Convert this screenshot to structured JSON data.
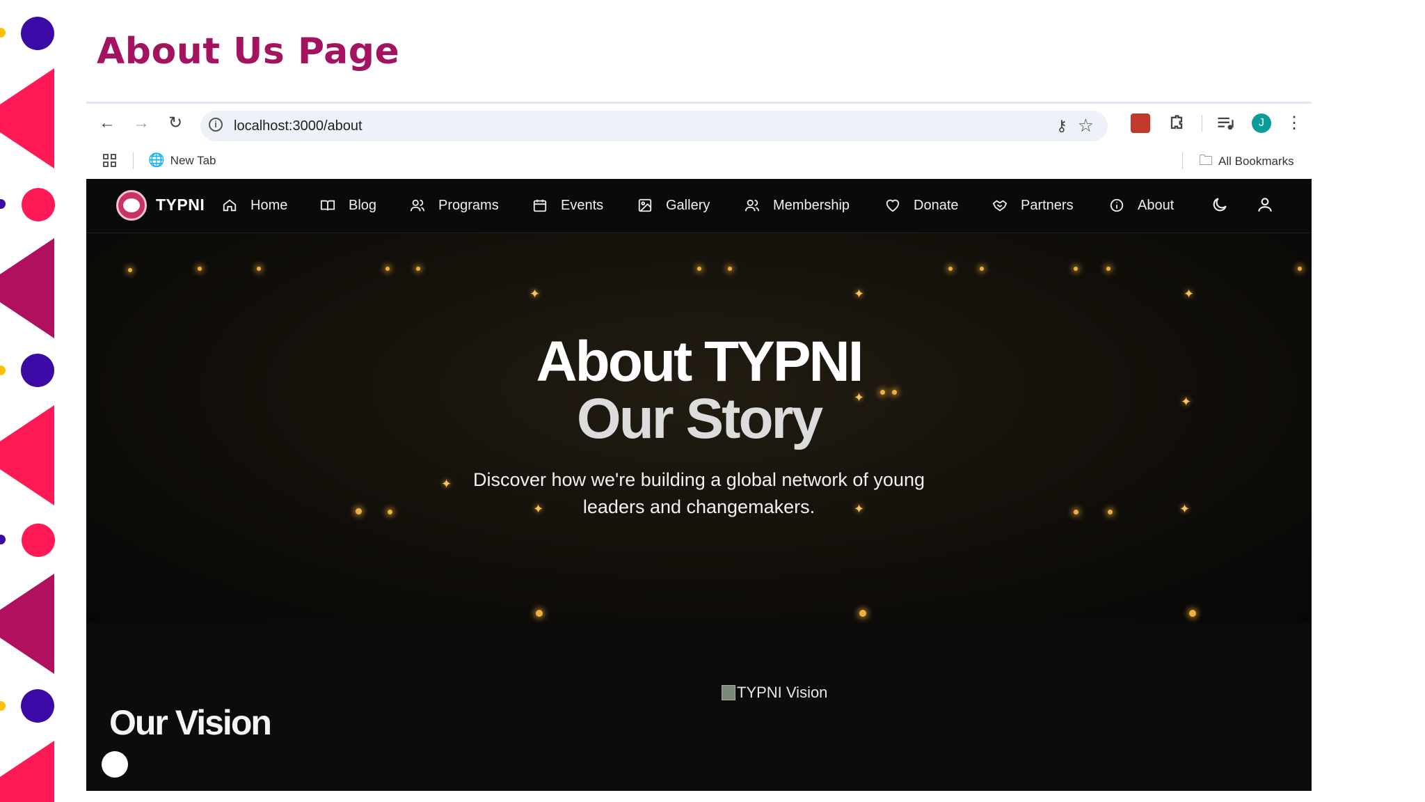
{
  "slide": {
    "title": "About Us Page"
  },
  "browser": {
    "url": "localhost:3000/about",
    "bookmarks": {
      "new_tab": "New Tab",
      "all_bookmarks": "All Bookmarks"
    },
    "profile_initial": "J"
  },
  "site": {
    "brand": "TYPNI",
    "nav": [
      {
        "label": "Home",
        "icon": "home-icon"
      },
      {
        "label": "Blog",
        "icon": "book-icon"
      },
      {
        "label": "Programs",
        "icon": "users-icon"
      },
      {
        "label": "Events",
        "icon": "calendar-icon"
      },
      {
        "label": "Gallery",
        "icon": "image-icon"
      },
      {
        "label": "Membership",
        "icon": "users-icon"
      },
      {
        "label": "Donate",
        "icon": "heart-icon"
      },
      {
        "label": "Partners",
        "icon": "handshake-icon"
      },
      {
        "label": "About",
        "icon": "info-icon"
      }
    ],
    "hero": {
      "title_line1": "About TYPNI",
      "title_line2": "Our Story",
      "subtitle_line1": "Discover how we're building a global network of young",
      "subtitle_line2": "leaders and changemakers."
    },
    "vision": {
      "image_alt": "TYPNI Vision",
      "title": "Our Vision"
    }
  },
  "colors": {
    "slide_title": "#a4135f",
    "deco_pink": "#ff1a55",
    "deco_magenta": "#b0105e",
    "deco_purple": "#3b0aa6",
    "deco_yellow": "#ffc107"
  }
}
